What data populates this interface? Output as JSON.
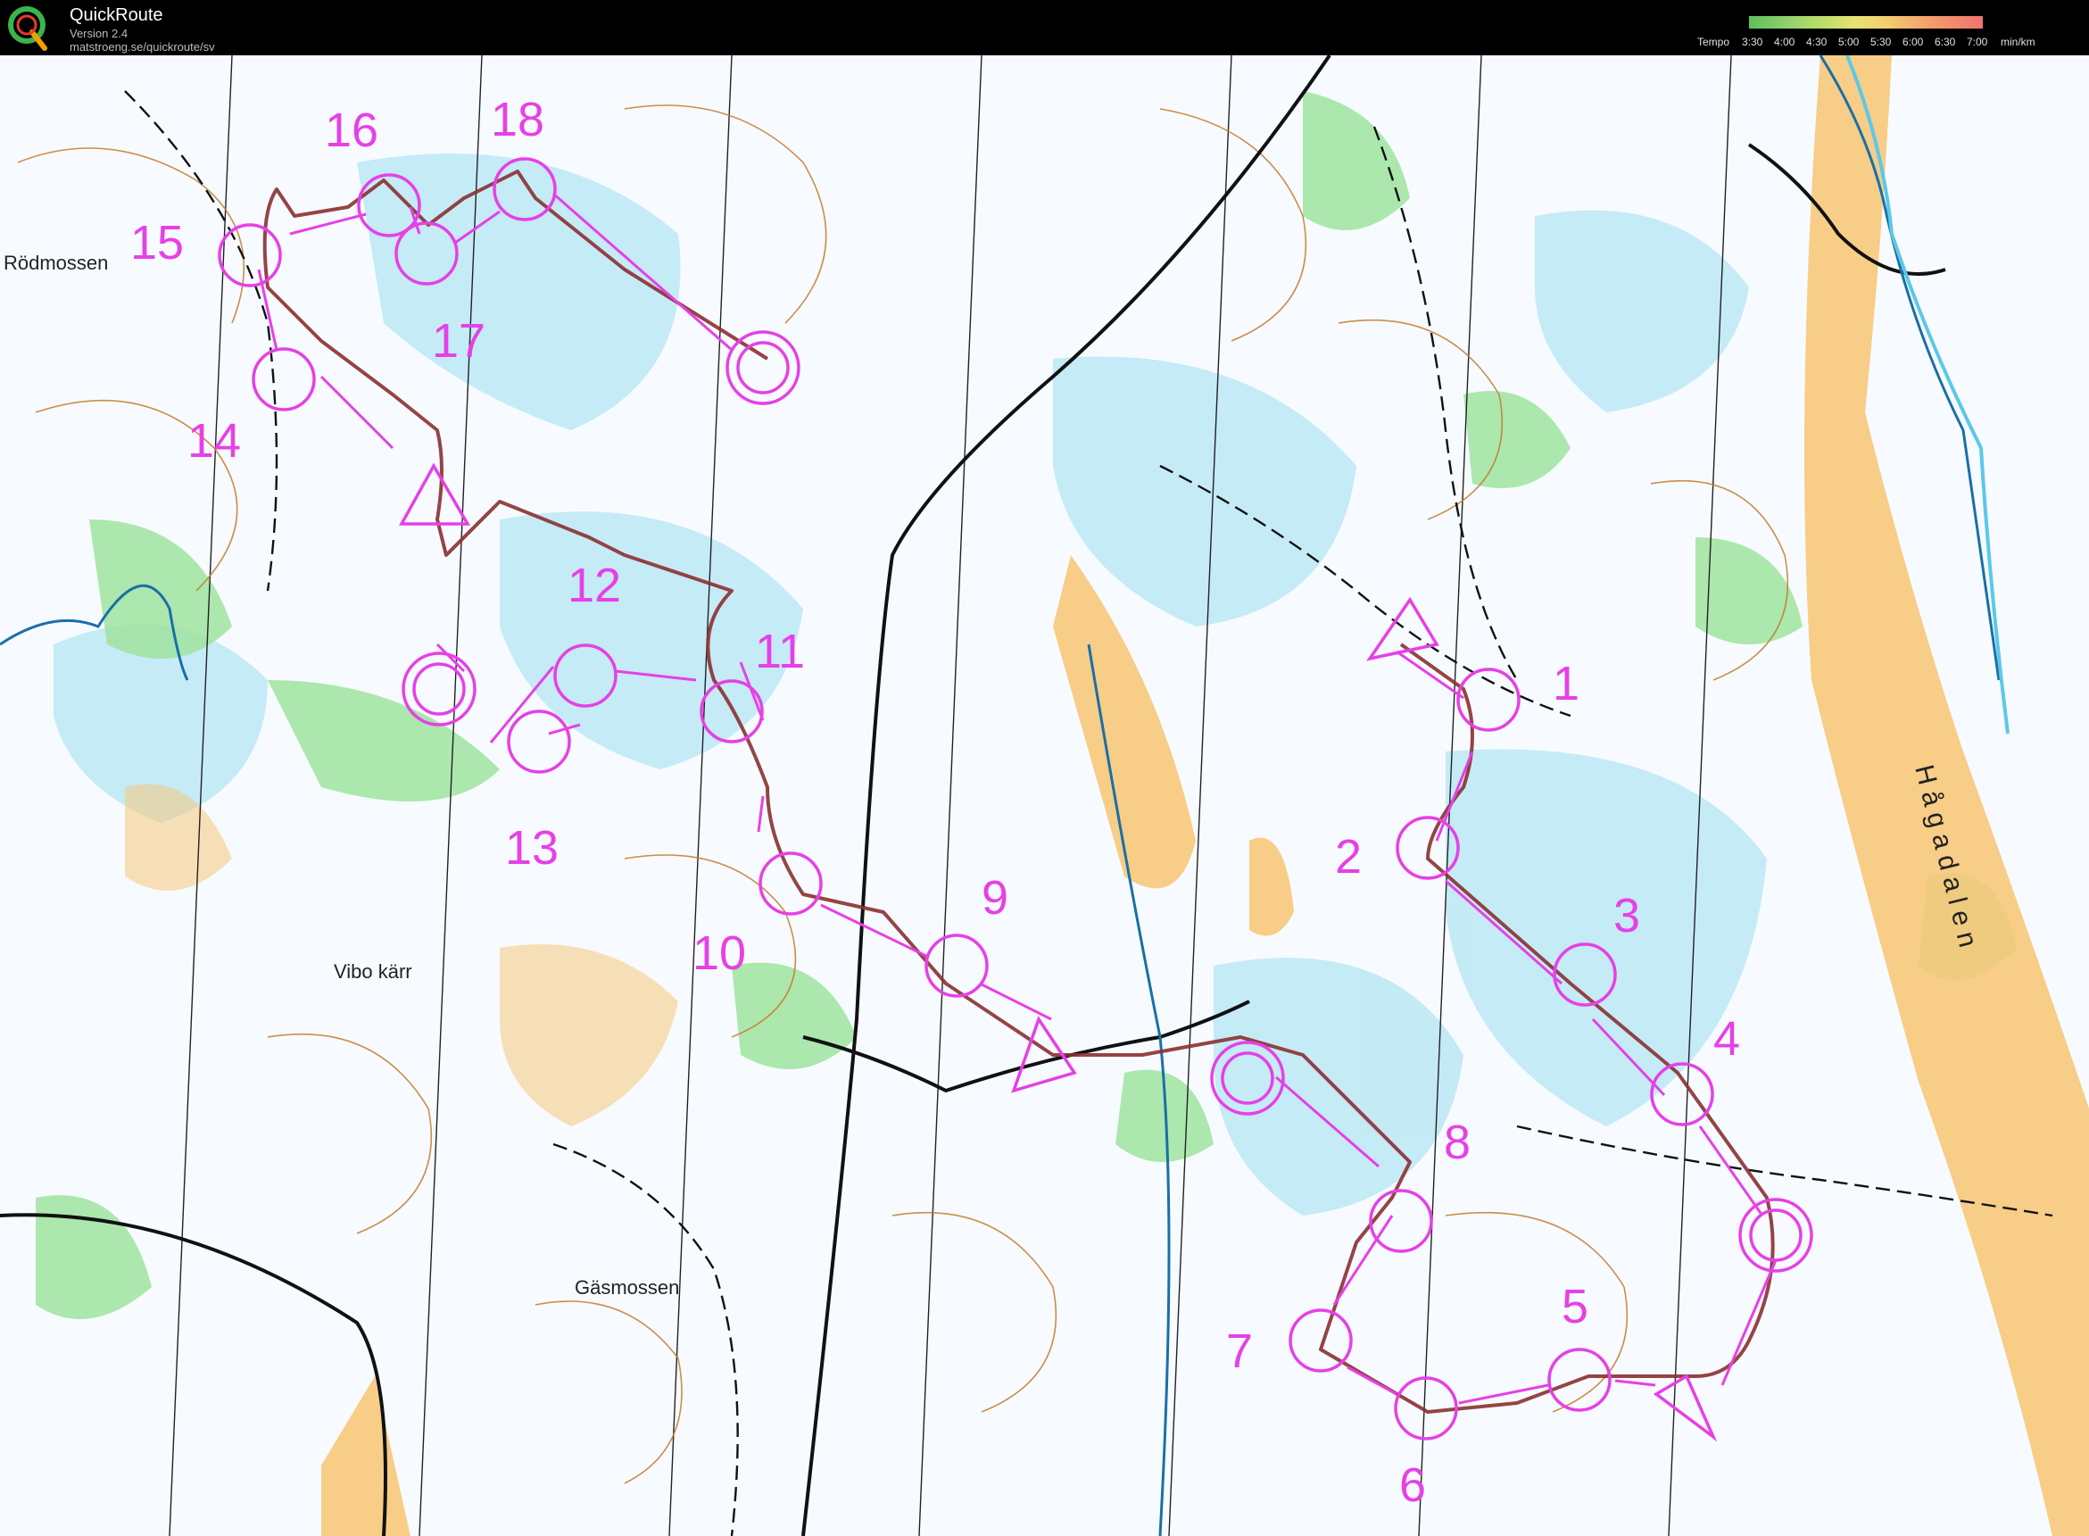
{
  "header": {
    "app_name": "QuickRoute",
    "version": "Version 2.4",
    "url": "matstroeng.se/quickroute/sv",
    "tempo_label": "Tempo",
    "tempo_ticks": [
      "3:30",
      "4:00",
      "4:30",
      "5:00",
      "5:30",
      "6:00",
      "6:30",
      "7:00"
    ],
    "tempo_unit": "min/km"
  },
  "map": {
    "colors": {
      "course": "#e640e6",
      "route": "#8a3030",
      "water": "#7fd9ee",
      "open": "#f6c87a",
      "green": "#8be08b",
      "contour": "#c47a2a"
    },
    "place_names": {
      "rodmossen": "Rödmossen",
      "vibo": "Vibo kärr",
      "gasmossen": "Gäsmossen",
      "hagadalen": "Hågadalen"
    },
    "course_a": {
      "start_label": "",
      "controls": [
        {
          "num": "1"
        },
        {
          "num": "2"
        },
        {
          "num": "3"
        },
        {
          "num": "4"
        },
        {
          "num": "5"
        },
        {
          "num": "6"
        },
        {
          "num": "7"
        },
        {
          "num": "8"
        }
      ]
    },
    "course_b": {
      "controls": [
        {
          "num": "9"
        },
        {
          "num": "10"
        },
        {
          "num": "11"
        },
        {
          "num": "12"
        },
        {
          "num": "13"
        },
        {
          "num": "14"
        },
        {
          "num": "15"
        },
        {
          "num": "16"
        },
        {
          "num": "17"
        },
        {
          "num": "18"
        }
      ]
    }
  }
}
